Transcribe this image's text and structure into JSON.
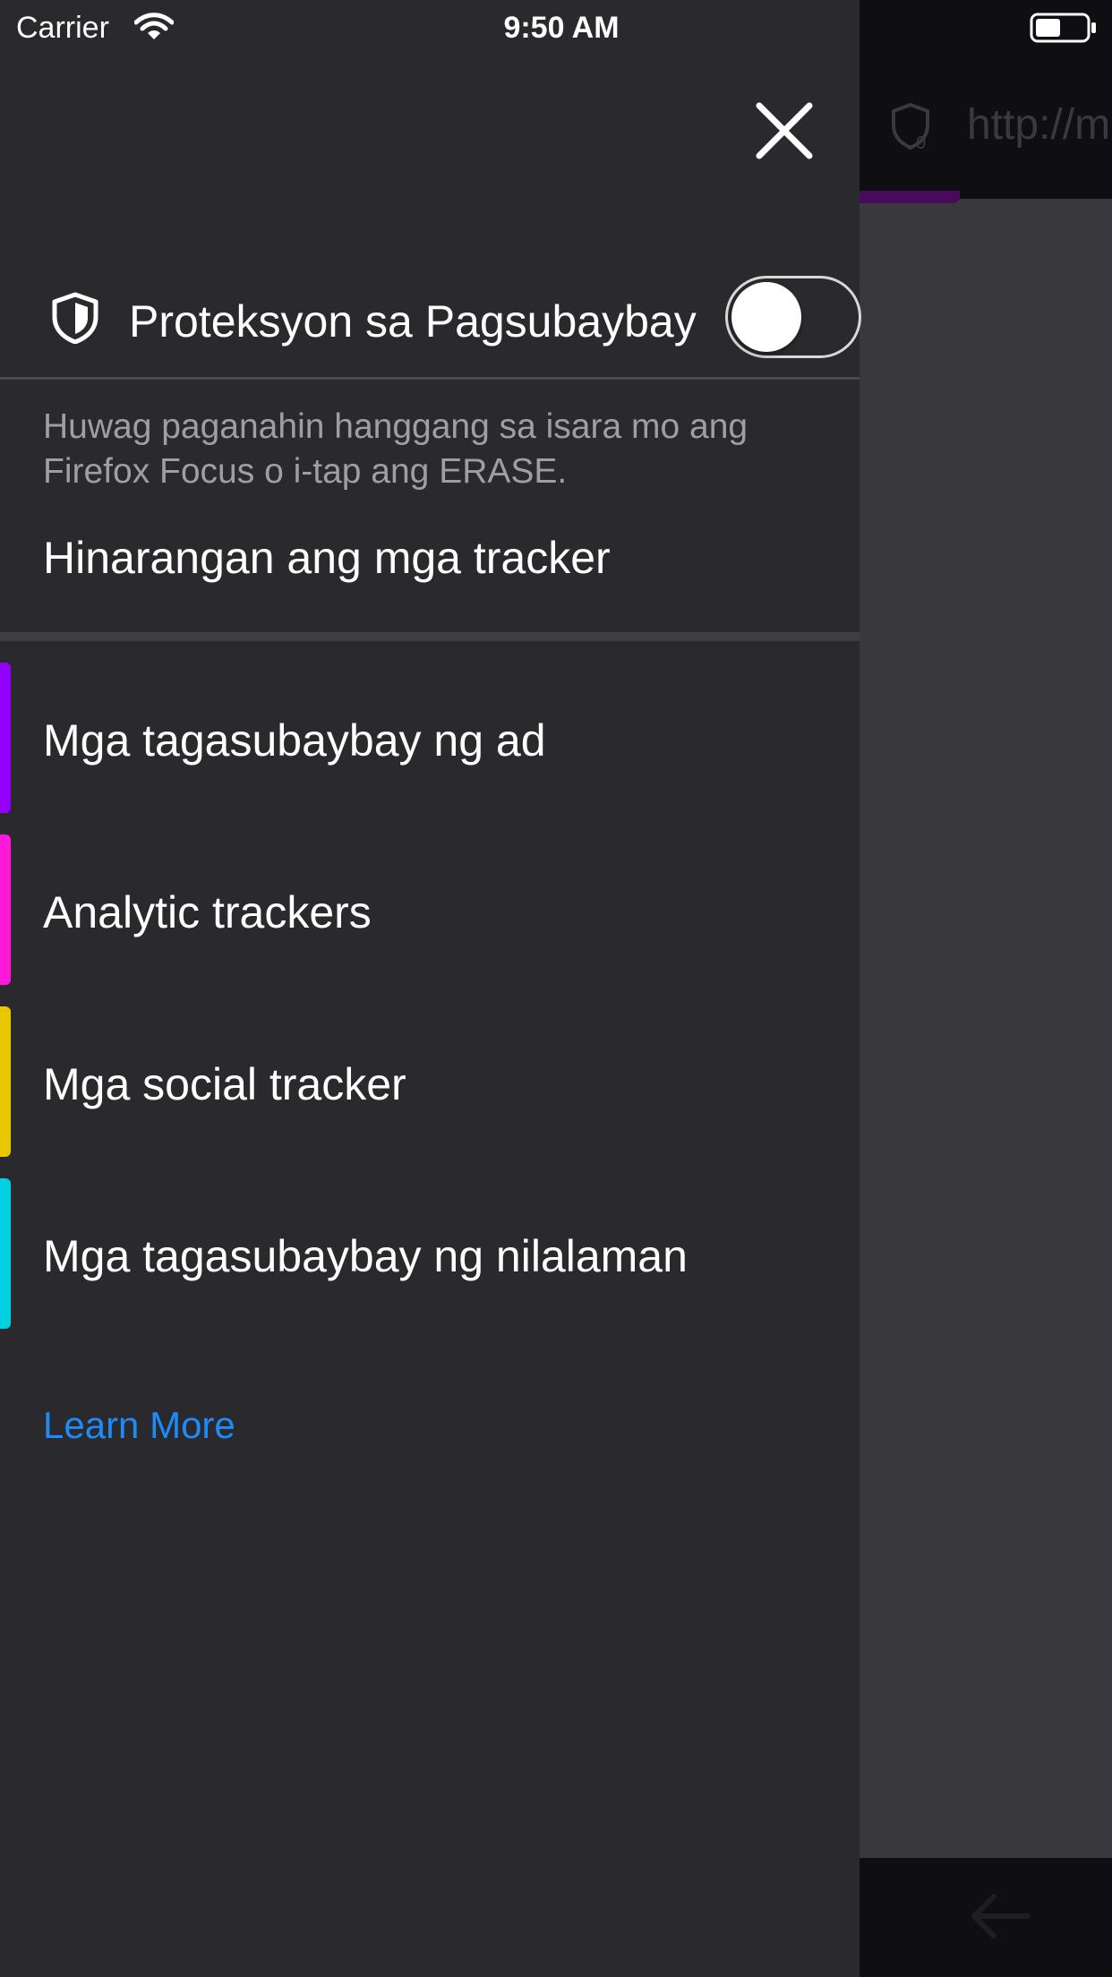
{
  "status_bar": {
    "carrier": "Carrier",
    "time": "9:50 AM"
  },
  "background": {
    "url_text": "http://m"
  },
  "panel": {
    "header_title": "Proteksyon sa Pagsubaybay",
    "toggle_on": false,
    "description": "Huwag paganahin hanggang sa isara mo ang Firefox Focus o i-tap ang ERASE.",
    "blocked_title": "Hinarangan ang mga tracker",
    "trackers": [
      {
        "label": "Mga tagasubaybay ng ad",
        "color": "#9400ff"
      },
      {
        "label": "Analytic trackers",
        "color": "#ff1ad9"
      },
      {
        "label": "Mga social tracker",
        "color": "#e8c600"
      },
      {
        "label": "Mga tagasubaybay ng nilalaman",
        "color": "#00d0e0"
      }
    ],
    "learn_more": "Learn More"
  },
  "icons": {
    "close": "close-icon",
    "shield": "shield-icon",
    "wifi": "wifi-icon",
    "battery": "battery-icon",
    "back": "back-arrow-icon"
  },
  "colors": {
    "panel_bg": "#2a2a2e",
    "link": "#1e8bf6",
    "toolbar_bg": "#0f0e12"
  }
}
